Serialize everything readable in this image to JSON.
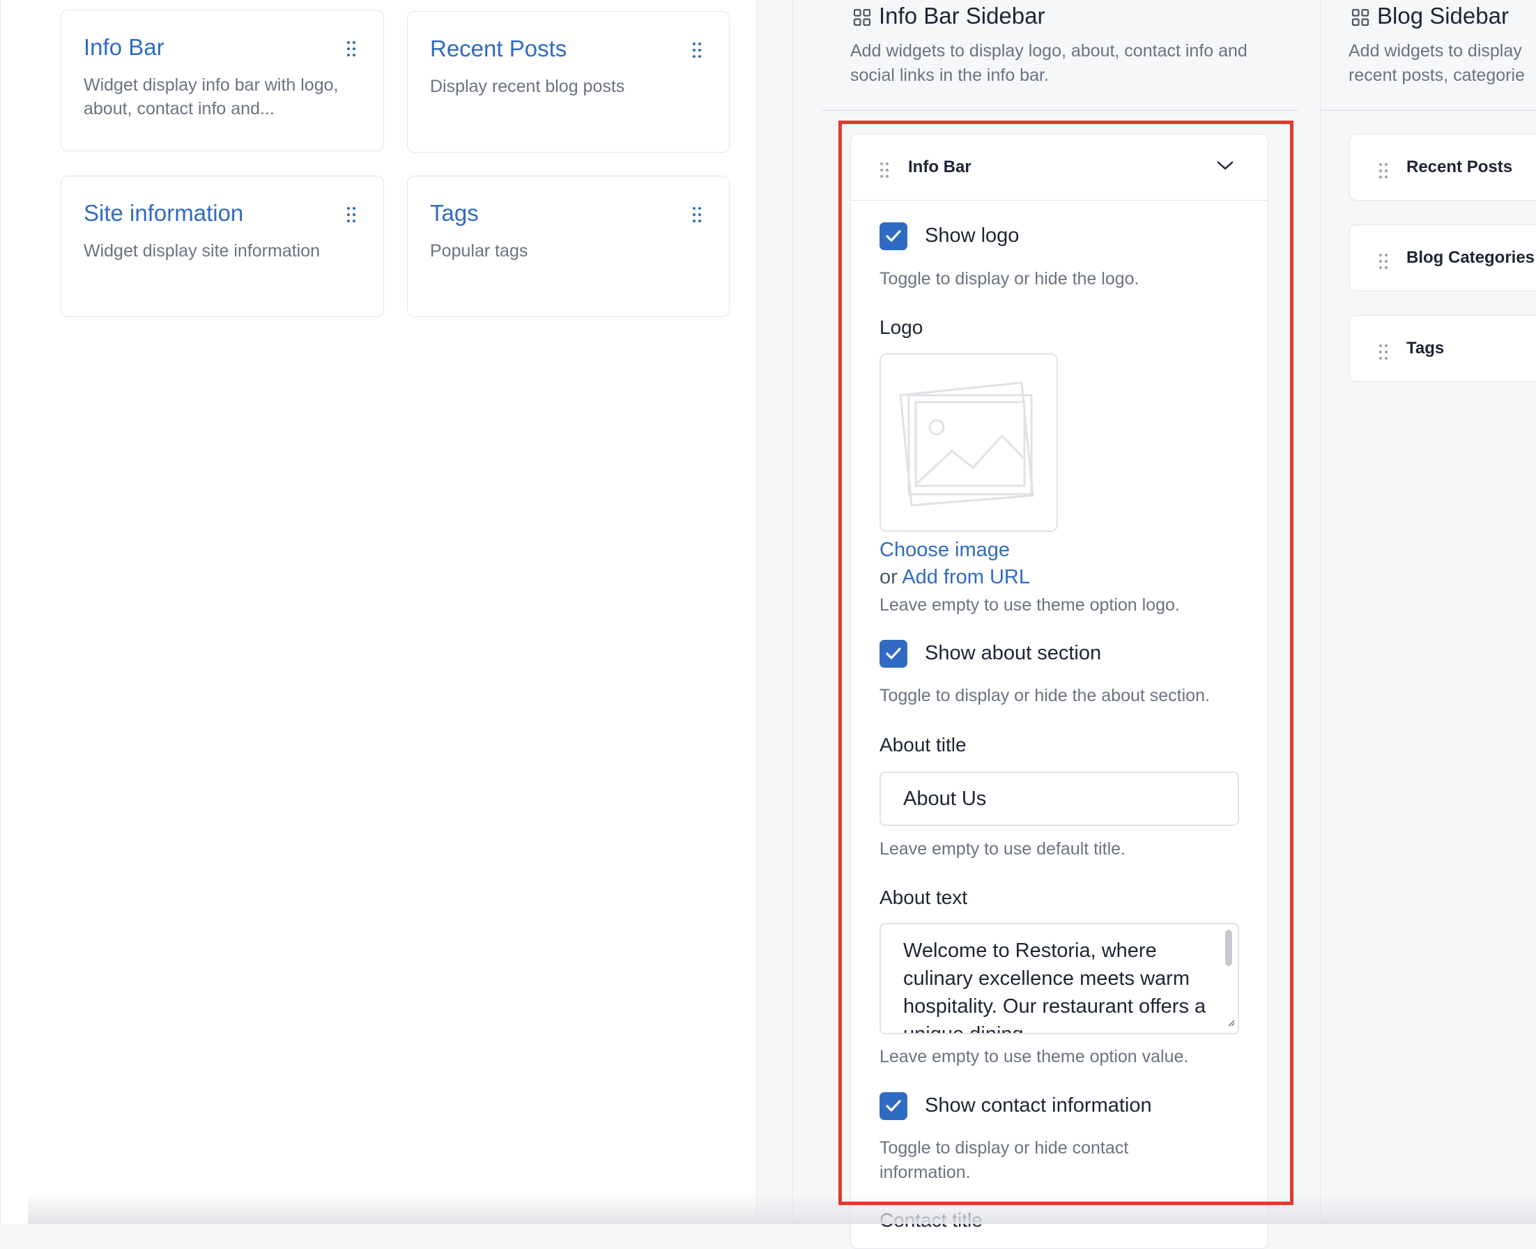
{
  "available_widgets": [
    {
      "title": "Info Bar",
      "description": "Widget display info bar with logo, about, contact info and..."
    },
    {
      "title": "Recent Posts",
      "description": "Display recent blog posts"
    },
    {
      "title": "Site information",
      "description": "Widget display site information"
    },
    {
      "title": "Tags",
      "description": "Popular tags"
    }
  ],
  "info_bar_sidebar": {
    "title": "Info Bar Sidebar",
    "description": "Add widgets to display logo, about, contact info and social links in the info bar.",
    "widget": {
      "title": "Info Bar",
      "show_logo": {
        "checked": true,
        "label": "Show logo",
        "hint": "Toggle to display or hide the logo."
      },
      "logo": {
        "label": "Logo",
        "choose_image": "Choose image",
        "or_text": "or",
        "add_from_url": "Add from URL",
        "hint": "Leave empty to use theme option logo."
      },
      "show_about": {
        "checked": true,
        "label": "Show about section",
        "hint": "Toggle to display or hide the about section."
      },
      "about_title": {
        "label": "About title",
        "value": "About Us",
        "hint": "Leave empty to use default title."
      },
      "about_text": {
        "label": "About text",
        "value": "Welcome to Restoria, where culinary excellence meets warm hospitality. Our restaurant offers a unique dining",
        "hint": "Leave empty to use theme option value."
      },
      "show_contact": {
        "checked": true,
        "label": "Show contact information",
        "hint": "Toggle to display or hide contact information."
      },
      "contact_title": {
        "label": "Contact title"
      }
    }
  },
  "blog_sidebar": {
    "title": "Blog Sidebar",
    "description": "Add widgets to display recent posts, categorie",
    "widgets": [
      "Recent Posts",
      "Blog Categories",
      "Tags"
    ]
  },
  "colors": {
    "accent": "#2f6bc2",
    "highlight_border": "#e03a2f"
  },
  "icons": [
    "drag-handle-icon",
    "widget-area-icon",
    "chevron-down-icon",
    "checkmark-icon",
    "image-placeholder-icon"
  ]
}
